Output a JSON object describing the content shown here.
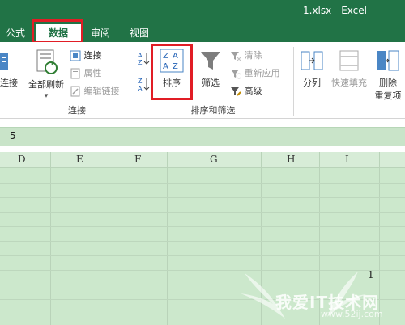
{
  "window": {
    "title": "1.xlsx - Excel"
  },
  "tabs": {
    "formula": "公式",
    "data": "数据",
    "review": "审阅",
    "view": "视图"
  },
  "ribbon": {
    "connections": {
      "partial_label": "连接",
      "refresh_all": "全部刷新",
      "connections": "连接",
      "properties": "属性",
      "edit_links": "编辑链接",
      "group_label": "连接"
    },
    "sort_filter": {
      "sort": "排序",
      "filter": "筛选",
      "clear": "清除",
      "reapply": "重新应用",
      "advanced": "高级",
      "group_label": "排序和筛选"
    },
    "data_tools": {
      "text_to_columns": "分列",
      "flash_fill": "快速填充",
      "remove_duplicates_line1": "删除",
      "remove_duplicates_line2": "重复项"
    }
  },
  "formula_bar": {
    "value": "5"
  },
  "grid": {
    "columns": [
      "D",
      "E",
      "F",
      "G",
      "H",
      "I"
    ],
    "cell_value": "1"
  },
  "watermark": {
    "text": "我爱IT技术网",
    "url": "www.52ij.com"
  },
  "colors": {
    "accent": "#217346",
    "highlight": "#e11d25",
    "sheet": "#cce8cc"
  }
}
